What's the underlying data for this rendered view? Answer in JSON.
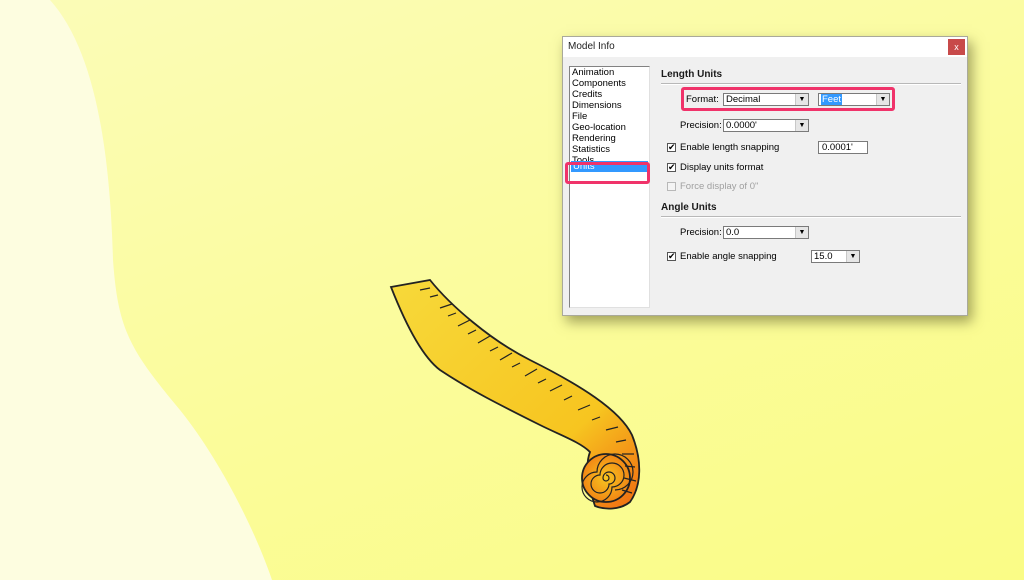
{
  "colors": {
    "background": "#fbfc9a",
    "background_wave": "#fdfdde",
    "highlight": "#f0336a",
    "selection": "#3399ff",
    "close_button": "#c84a4a"
  },
  "dialog": {
    "title": "Model Info",
    "close_label": "x",
    "sidebar": {
      "items": [
        {
          "label": "Animation"
        },
        {
          "label": "Components"
        },
        {
          "label": "Credits"
        },
        {
          "label": "Dimensions"
        },
        {
          "label": "File"
        },
        {
          "label": "Geo-location"
        },
        {
          "label": "Rendering"
        },
        {
          "label": "Statistics"
        },
        {
          "label": "Tools"
        },
        {
          "label": "Units",
          "selected": true
        }
      ]
    },
    "length_units": {
      "title": "Length Units",
      "format_label": "Format:",
      "format_value": "Decimal",
      "unit_value": "Feet",
      "precision_label": "Precision:",
      "precision_value": "0.0000'",
      "length_snapping_label": "Enable length snapping",
      "length_snapping_checked": true,
      "length_snapping_value": "0.0001'",
      "display_units_label": "Display units format",
      "display_units_checked": true,
      "force_display_label": "Force display of 0\"",
      "force_display_checked": false,
      "force_display_enabled": false
    },
    "angle_units": {
      "title": "Angle Units",
      "precision_label": "Precision:",
      "precision_value": "0.0",
      "angle_snapping_label": "Enable angle snapping",
      "angle_snapping_checked": true,
      "angle_snapping_value": "15.0"
    },
    "icons": {
      "dropdown": "▼",
      "check": "✔"
    }
  },
  "illustration": {
    "name": "measuring tape",
    "colors": [
      "#f7d22a",
      "#f59a1a",
      "#f06a10"
    ]
  }
}
